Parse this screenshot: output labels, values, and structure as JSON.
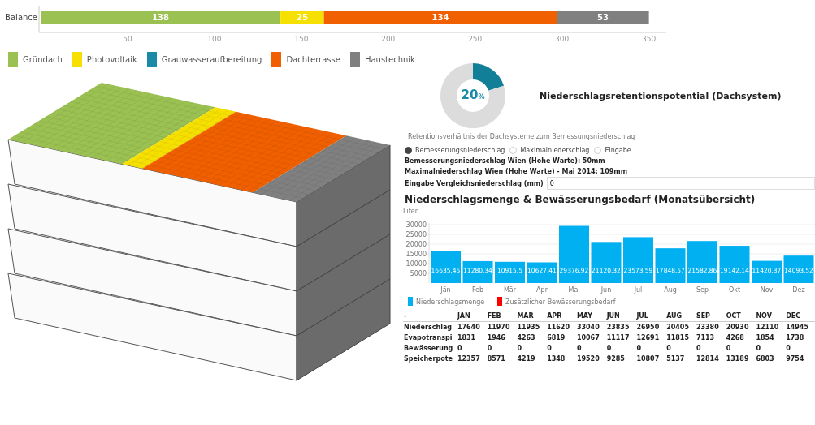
{
  "balance_chart": {
    "chart_data": {
      "type": "bar",
      "orientation": "horizontal",
      "stacked": true,
      "data_labels": true,
      "categories": [
        "Balance"
      ],
      "xlim": [
        0,
        360
      ],
      "xticks": [
        50,
        100,
        150,
        200,
        250,
        300,
        350
      ],
      "series": [
        {
          "name": "Gründach",
          "color": "#9bc152",
          "values": [
            138
          ]
        },
        {
          "name": "Photovoltaik",
          "color": "#f6e000",
          "values": [
            25
          ]
        },
        {
          "name": "Grauwasseraufbereitung",
          "color": "#1a8aa6",
          "values": [
            null
          ]
        },
        {
          "name": "Dachterrasse",
          "color": "#f06000",
          "values": [
            134
          ]
        },
        {
          "name": "Haustechnik",
          "color": "#808080",
          "values": [
            53
          ]
        }
      ]
    }
  },
  "retention": {
    "value": "20",
    "unit": "%",
    "title": "Niederschlagsretentionspotential (Dachsystem)",
    "caption": "Retentionsverhältnis der Dachsysteme zum Bemessungsniederschlag",
    "chart_data": {
      "type": "donut",
      "values": [
        20,
        80
      ]
    }
  },
  "precipitation_options": [
    {
      "label": "Bemesserungsniederschlag",
      "selected": true
    },
    {
      "label": "Maximalniederschlag",
      "selected": false
    },
    {
      "label": "Eingabe",
      "selected": false
    }
  ],
  "info_lines": [
    "Bemesserungsniederschlag Wien (Hohe Warte): 50mm",
    "Maximalniederschlag Wien (Hohe Warte) - Mai 2014: 109mm"
  ],
  "comparison_input": {
    "label": "Eingabe Vergleichsniederschlag (mm)",
    "value": "0"
  },
  "monthly_section": {
    "title": "Niederschlagsmenge & Bewässerungsbedarf (Monatsübersicht)",
    "chart_data": {
      "type": "bar",
      "ylabel": "Liter",
      "ylim": [
        0,
        30000
      ],
      "yticks": [
        5000,
        10000,
        15000,
        20000,
        25000,
        30000
      ],
      "grid": true,
      "data_labels": true,
      "categories": [
        "Jän",
        "Feb",
        "Mär",
        "Apr",
        "Mai",
        "Jun",
        "Jul",
        "Aug",
        "Sep",
        "Okt",
        "Nov",
        "Dez"
      ],
      "series": [
        {
          "name": "Niederschlagsmenge",
          "color": "#00b0f0",
          "values": [
            16635.45,
            11280.34,
            10915.5,
            10627.41,
            29376.92,
            21120.32,
            23573.59,
            17848.57,
            21582.86,
            19142.14,
            11420.37,
            14093.52
          ]
        },
        {
          "name": "Zusätzlicher Bewässerungsbedarf",
          "color": "#ff0000",
          "values": [
            null,
            null,
            null,
            null,
            null,
            null,
            null,
            null,
            null,
            null,
            null,
            null
          ]
        }
      ]
    }
  },
  "table": {
    "columns": [
      "-",
      "JAN",
      "FEB",
      "MAR",
      "APR",
      "MAY",
      "JUN",
      "JUL",
      "AUG",
      "SEP",
      "OCT",
      "NOV",
      "DEC"
    ],
    "rows": [
      [
        "Niederschlag",
        "17640",
        "11970",
        "11935",
        "11620",
        "33040",
        "23835",
        "26950",
        "20405",
        "23380",
        "20930",
        "12110",
        "14945"
      ],
      [
        "Evapotranspi",
        "1831",
        "1946",
        "4263",
        "6819",
        "10067",
        "11117",
        "12691",
        "11815",
        "7113",
        "4268",
        "1854",
        "1738"
      ],
      [
        "Bewässerung",
        "0",
        "0",
        "0",
        "0",
        "0",
        "0",
        "0",
        "0",
        "0",
        "0",
        "0",
        "0"
      ],
      [
        "Speicherpote",
        "12357",
        "8571",
        "4219",
        "1348",
        "19520",
        "9285",
        "10807",
        "5137",
        "12814",
        "13189",
        "6803",
        "9754"
      ]
    ]
  }
}
